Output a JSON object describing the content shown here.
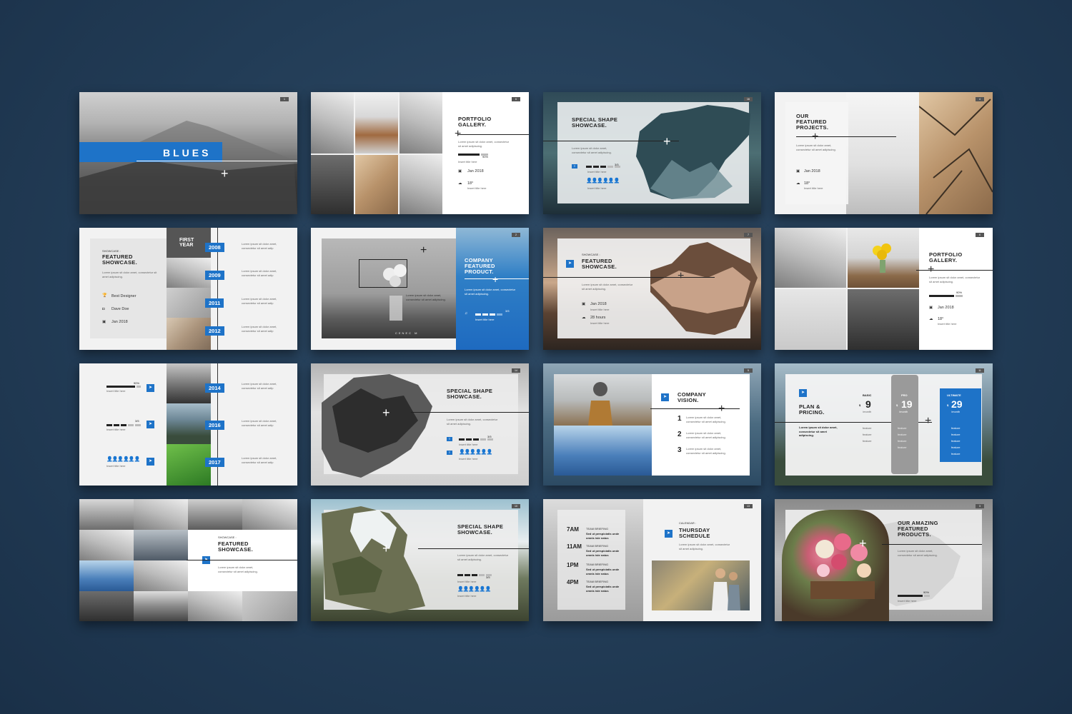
{
  "s1": {
    "num": "1",
    "title": "BLUES"
  },
  "s2": {
    "num": "6",
    "title": "PORTFOLIO GALLERY.",
    "body": "Lorem ipsum sit dolor amet, consectetur sit amet adipiscing.",
    "pct": "90%",
    "cap": "Insert title here",
    "date": "Jan 2018",
    "temp": "18°",
    "sub": "Insert title here"
  },
  "s3": {
    "num": "16",
    "title": "SPECIAL SHAPE SHOWCASE.",
    "body": "Lorem ipsum sit dolor amet, consectetur sit amet adipiscing.",
    "frac": "3/5",
    "cap1": "Insert title here",
    "cap2": "Insert title here"
  },
  "s4": {
    "num": "4",
    "title": "OUR FEATURED PROJECTS.",
    "body": "Lorem ipsum sit dolor amet, consectetur sit amet adipiscing.",
    "date": "Jan 2018",
    "temp": "18°",
    "sub": "Insert title here"
  },
  "s5": {
    "kicker": "SHOWCASE :",
    "title": "FEATURED SHOWCASE.",
    "body": "Lorem ipsum sit dolor amet, consectetur sit amet adipiscing.",
    "first": "FIRST YEAR",
    "items": [
      "Best Designer",
      "Dave Doe",
      "Jan 2018"
    ],
    "years": [
      "2008",
      "2009",
      "2011",
      "2012"
    ],
    "txt": "Lorem ipsum sit dolor amet, consectetur sit amet adip"
  },
  "s6": {
    "num": "2",
    "title": "COMPANY FEATURED PRODUCT.",
    "body": "Lorem ipsum sit dolor amet, consectetur sit amet adipiscing.",
    "frac": "3/5",
    "cap": "Insert title here",
    "photo_text": "CENEC M"
  },
  "s7": {
    "num": "7",
    "kicker": "SHOWCASE :",
    "title": "FEATURED SHOWCASE.",
    "body": "Lorem ipsum sit dolor amet, consectetur sit amet adipiscing.",
    "date": "Jan 2018",
    "hours": "28 hours",
    "sub": "Insert title here"
  },
  "s8": {
    "num": "6",
    "title": "PORTFOLIO GALLERY.",
    "body": "Lorem ipsum sit dolor amet, consectetur sit amet adipiscing.",
    "pct": "90%",
    "date": "Jan 2018",
    "temp": "18°",
    "sub": "Insert title here"
  },
  "s9": {
    "pct": "90%",
    "frac": "3/5",
    "cap": "Insert title here",
    "years": [
      "2014",
      "2016",
      "2017"
    ],
    "txt": "Lorem ipsum sit dolor amet, consectetur sit amet adip"
  },
  "s10": {
    "num": "14",
    "title": "SPECIAL SHAPE SHOWCASE.",
    "body": "Lorem ipsum sit dolor amet, consectetur sit amet adipiscing.",
    "frac": "3/5",
    "cap": "Insert title here"
  },
  "s11": {
    "num": "5",
    "title": "COMPANY VISION.",
    "items": [
      "1",
      "2",
      "3"
    ],
    "txt": "Lorem ipsum sit dolor amet, consectetur sit amet adipiscing."
  },
  "s12": {
    "num": "11",
    "title": "PLAN & PRICING.",
    "body": "Lorem ipsum sit dolor amet, consectetur sit amet adipiscing.",
    "plans": [
      {
        "name": "BASIC",
        "price": "9",
        "unit": "/month"
      },
      {
        "name": "PRO",
        "price": "19",
        "unit": "/month"
      },
      {
        "name": "ULTIMATE",
        "price": "29",
        "unit": "/month"
      }
    ],
    "feature": "feature",
    "currency": "$"
  },
  "s13": {
    "kicker": "SHOWCASE :",
    "title": "FEATURED SHOWCASE.",
    "body": "Lorem ipsum sit dolor amet, consectetur sit amet adipiscing."
  },
  "s14": {
    "num": "10",
    "title": "SPECIAL SHAPE SHOWCASE.",
    "body": "Lorem ipsum sit dolor amet, consectetur sit amet adipiscing.",
    "frac": "3/5",
    "cap": "Insert title here"
  },
  "s15": {
    "num": "13",
    "kicker": "CALENDAR :",
    "title": "THURSDAY SCHEDULE",
    "body": "Lorem ipsum sit dolor amet, consectetur sit amet adipiscing.",
    "times": [
      "7AM",
      "11AM",
      "1PM",
      "4PM"
    ],
    "event": "TEAM BRIEFING",
    "evtxt": "Sed ut perspiciatis unde omnis iste natus"
  },
  "s16": {
    "num": "3",
    "title": "OUR AMAZING FEATURED PRODUCTS.",
    "body": "Lorem ipsum sit dolor amet, consectetur sit amet adipiscing.",
    "pct": "90%",
    "cap": "Insert title here"
  },
  "icons": [
    "plane-icon",
    "trophy-icon",
    "camera-icon",
    "calendar-icon",
    "cloud-icon",
    "music-icon",
    "chat-icon",
    "person-icon"
  ],
  "colors": {
    "accent": "#1e73c8",
    "background": "#223c56",
    "slide": "#f2f2f2",
    "text": "#222222"
  }
}
